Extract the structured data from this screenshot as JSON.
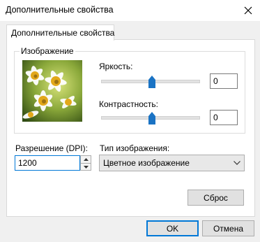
{
  "window": {
    "title": "Дополнительные свойства"
  },
  "tab": {
    "label": "Дополнительные свойства"
  },
  "image_group": {
    "label": "Изображение"
  },
  "brightness": {
    "label": "Яркость:",
    "value": "0",
    "level": 0.5
  },
  "contrast": {
    "label": "Контрастность:",
    "value": "0",
    "level": 0.5
  },
  "resolution": {
    "label": "Разрешение (DPI):",
    "value": "1200"
  },
  "image_type": {
    "label": "Тип изображения:",
    "selected": "Цветное изображение"
  },
  "buttons": {
    "reset": "Сброс",
    "ok": "OK",
    "cancel": "Отмена"
  },
  "colors": {
    "accent": "#0078d7",
    "thumb": "#1a73c4"
  }
}
